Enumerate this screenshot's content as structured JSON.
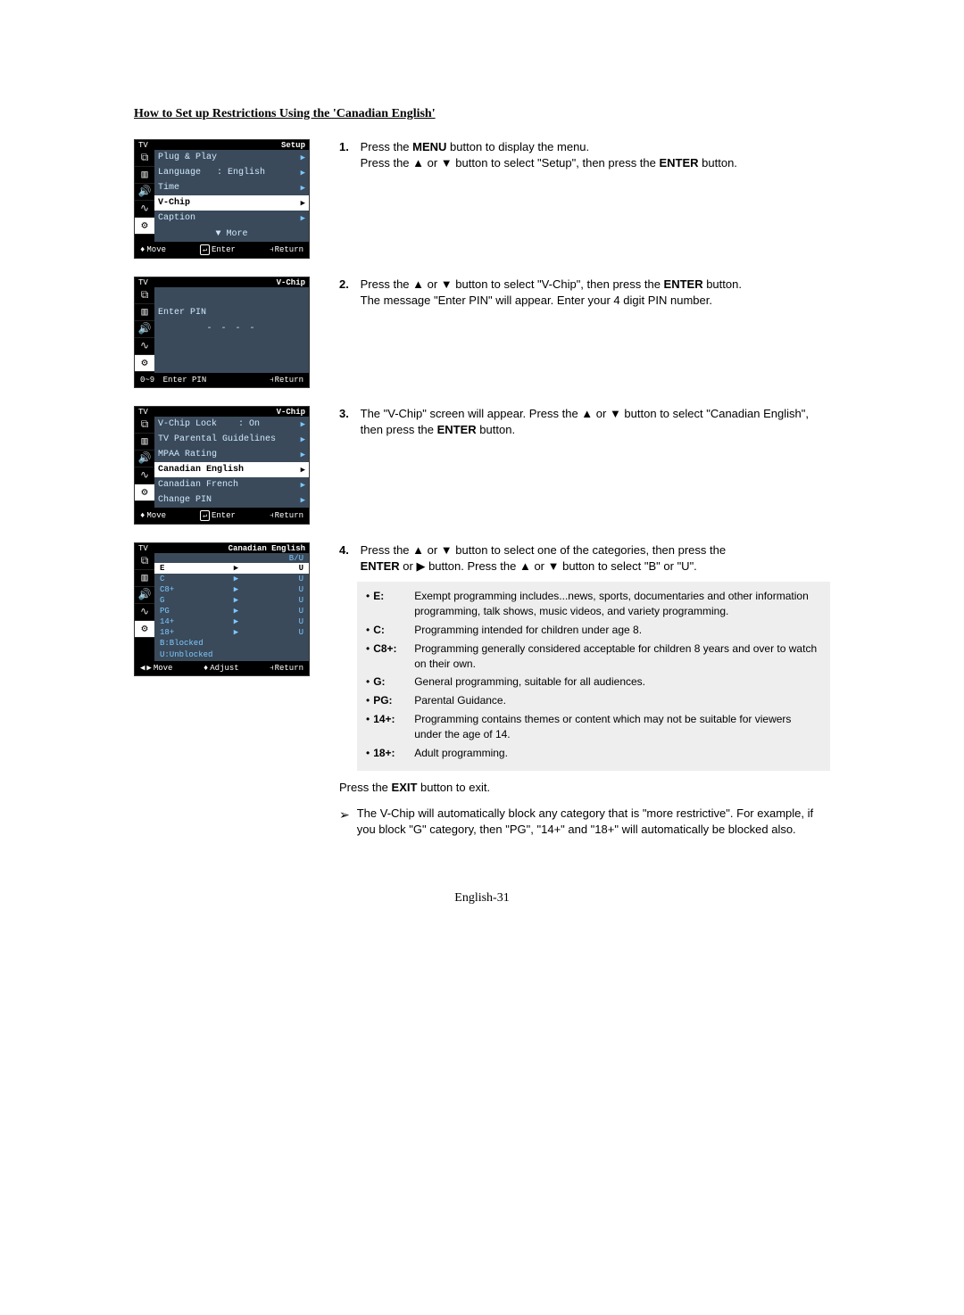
{
  "title": "How to Set up Restrictions Using the 'Canadian English'",
  "page_footer": "English-31",
  "steps": {
    "s1": {
      "num": "1.",
      "line1_a": "Press the ",
      "line1_b": "MENU",
      "line1_c": " button to display the menu.",
      "line2_a": "Press the ▲ or ▼ button to select \"Setup\", then press the ",
      "line2_b": "ENTER",
      "line2_c": " button."
    },
    "s2": {
      "num": "2.",
      "line1_a": "Press the ▲ or ▼ button to select \"V-Chip\", then press the ",
      "line1_b": "ENTER",
      "line1_c": " button.",
      "line2": "The message \"Enter PIN\" will appear. Enter your 4 digit PIN number."
    },
    "s3": {
      "num": "3.",
      "line1": "The \"V-Chip\" screen will appear. Press the ▲ or ▼ button to select \"Canadian English\", then press the ",
      "line1_b": "ENTER",
      "line1_c": " button."
    },
    "s4": {
      "num": "4.",
      "line1": "Press the ▲ or ▼ button to select one of the categories, then press the ",
      "line2_a": "ENTER",
      "line2_b": " or ▶ button. Press the ▲ or ▼ button to select \"B\" or \"U\"."
    },
    "exit_a": "Press the ",
    "exit_b": "EXIT",
    "exit_c": " button to exit.",
    "note": "The V-Chip will automatically block any category that is \"more restrictive\". For example, if you block \"G\" category, then \"PG\", \"14+\" and \"18+\" will automatically be blocked also."
  },
  "defs": [
    {
      "k": "E:",
      "v": "Exempt programming includes...news, sports, documentaries and other information programming, talk shows, music videos, and variety programming."
    },
    {
      "k": "C:",
      "v": "Programming intended for children under age 8."
    },
    {
      "k": "C8+:",
      "v": "Programming generally considered acceptable for children 8 years and over to watch on their own."
    },
    {
      "k": "G:",
      "v": "General programming, suitable for all audiences."
    },
    {
      "k": "PG:",
      "v": "Parental Guidance."
    },
    {
      "k": "14+:",
      "v": "Programming contains themes or content which may not be suitable for viewers under the age of 14."
    },
    {
      "k": "18+:",
      "v": "Adult programming."
    }
  ],
  "osd_common": {
    "tv": "TV",
    "move": "Move",
    "enter": "Enter",
    "return": "Return",
    "adjust": "Adjust",
    "enter_pin": "Enter PIN",
    "num09": "0~9"
  },
  "osd1": {
    "title_right": "Setup",
    "items": [
      {
        "label": "Plug & Play",
        "value": ""
      },
      {
        "label": "Language",
        "value": ": English"
      },
      {
        "label": "Time",
        "value": ""
      },
      {
        "label": "V-Chip",
        "value": "",
        "hl": true
      },
      {
        "label": "Caption",
        "value": ""
      }
    ],
    "more": "▼ More"
  },
  "osd2": {
    "title_right": "V-Chip",
    "label": "Enter PIN",
    "dashes": "- - - -"
  },
  "osd3": {
    "title_right": "V-Chip",
    "items": [
      {
        "label": "V-Chip Lock",
        "value": ": On"
      },
      {
        "label": "TV Parental Guidelines",
        "value": ""
      },
      {
        "label": "MPAA Rating",
        "value": ""
      },
      {
        "label": "Canadian English",
        "value": "",
        "hl": true
      },
      {
        "label": "Canadian French",
        "value": ""
      },
      {
        "label": "Change PIN",
        "value": ""
      }
    ]
  },
  "osd4": {
    "title_right": "Canadian English",
    "header": "B/U",
    "rows": [
      {
        "cat": "E",
        "bu": "U",
        "hl": true
      },
      {
        "cat": "C",
        "bu": "U"
      },
      {
        "cat": "C8+",
        "bu": "U"
      },
      {
        "cat": "G",
        "bu": "U"
      },
      {
        "cat": "PG",
        "bu": "U"
      },
      {
        "cat": "14+",
        "bu": "U"
      },
      {
        "cat": "18+",
        "bu": "U"
      }
    ],
    "legend1": "B:Blocked",
    "legend2": "U:Unblocked"
  }
}
